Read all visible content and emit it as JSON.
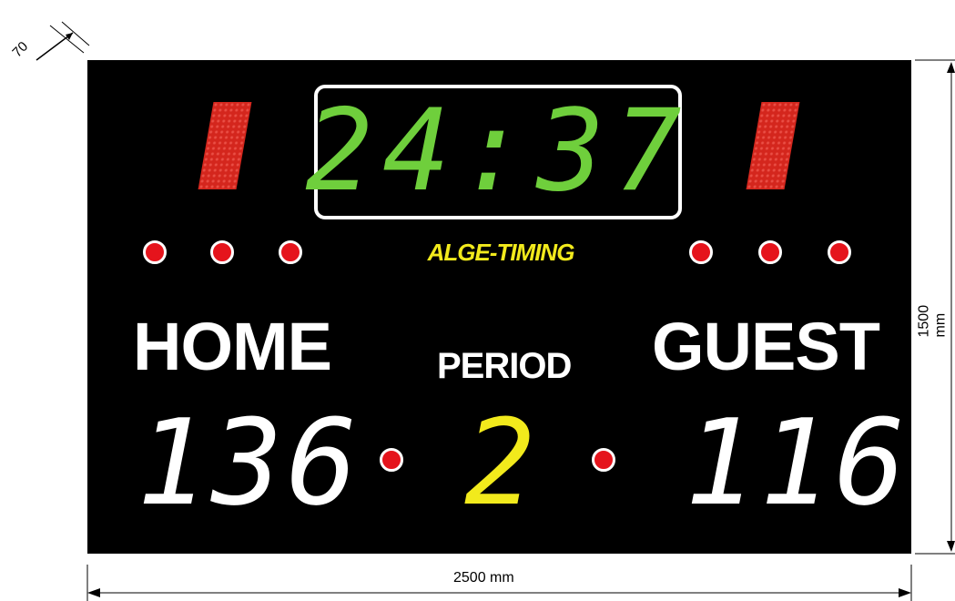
{
  "dimensions": {
    "depth": "70",
    "height": "1500 mm",
    "width": "2500 mm"
  },
  "clock": {
    "value": "24:37",
    "color": "#6fcf3c"
  },
  "brand": {
    "label": "ALGE-TIMING",
    "color": "#f2ea1c"
  },
  "teams": {
    "home": {
      "label": "HOME",
      "score": "136"
    },
    "guest": {
      "label": "GUEST",
      "score": "116"
    }
  },
  "period": {
    "label": "PERIOD",
    "value": "2",
    "color": "#f2ea1c"
  },
  "colors": {
    "board": "#000000",
    "lamp": "#e5141c",
    "bar": "#d4261d"
  }
}
